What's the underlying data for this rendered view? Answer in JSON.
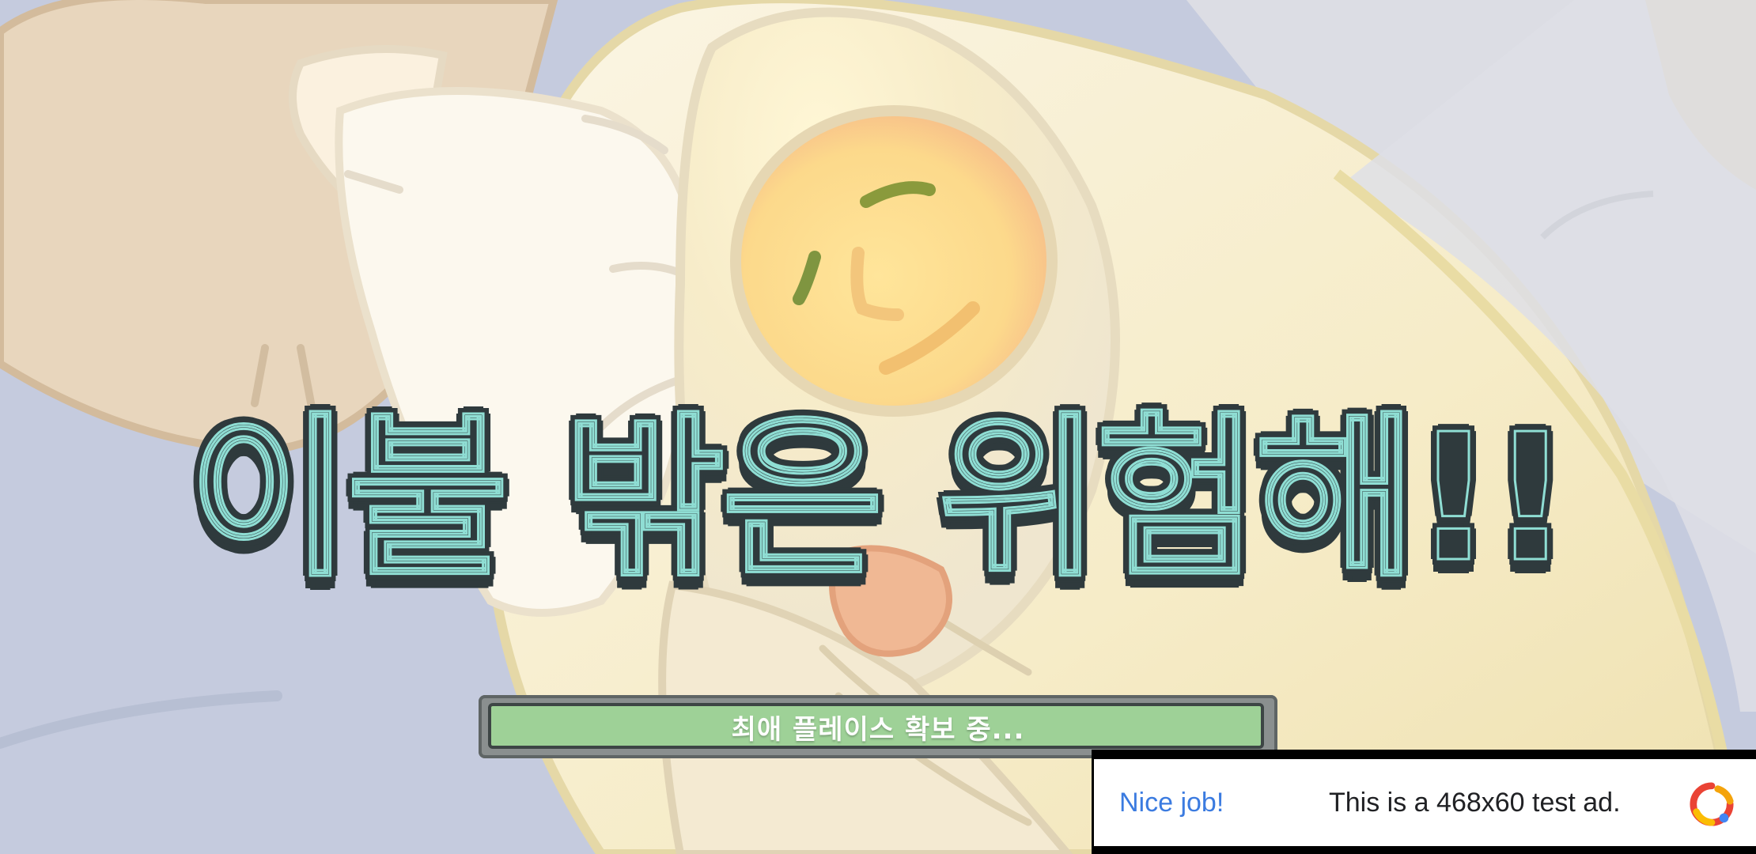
{
  "screen": {
    "title": "이불 밖은 위험해!!"
  },
  "loading": {
    "label": "최애 플레이스 확보 중...",
    "progress_fraction": 0.995
  },
  "ad": {
    "headline": "Nice job!",
    "body": "This is a 468x60 test ad.",
    "logo_icon": "adsense-logo-icon",
    "headline_color": "#3b7be0"
  },
  "colors": {
    "title_fill": "#3aa39c",
    "title_outline": "#2f3a3d",
    "progress_fill": "#9ed197",
    "background": "#c3c9dd"
  }
}
